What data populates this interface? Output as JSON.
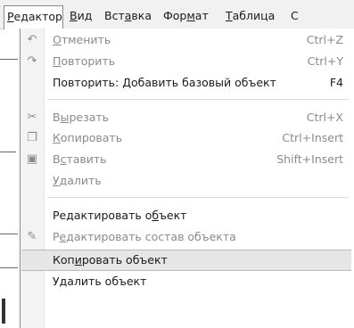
{
  "menubar": {
    "items": [
      {
        "text": "Редактор",
        "active": true
      },
      {
        "text": "Вид"
      },
      {
        "text": "Вставка"
      },
      {
        "text": "Формат"
      },
      {
        "text": "Таблица"
      },
      {
        "text": "С"
      }
    ]
  },
  "menu": {
    "undo": {
      "label": "Отменить",
      "shortcut": "Ctrl+Z",
      "icon": "undo-icon"
    },
    "redo": {
      "label": "Повторить",
      "shortcut": "Ctrl+Y",
      "icon": "redo-icon"
    },
    "repeat": {
      "label": "Повторить: Добавить базовый объект",
      "shortcut": "F4"
    },
    "cut": {
      "label": "Вырезать",
      "shortcut": "Ctrl+X",
      "icon": "scissors-icon"
    },
    "copy": {
      "label": "Копировать",
      "shortcut": "Ctrl+Insert",
      "icon": "copy-icon"
    },
    "paste": {
      "label": "Вставить",
      "shortcut": "Shift+Insert",
      "icon": "paste-icon"
    },
    "delete": {
      "label": "Удалить"
    },
    "edit_object": {
      "label": "Редактировать объект"
    },
    "edit_composition": {
      "label": "Редактировать состав объекта",
      "icon": "edit-composition-icon"
    },
    "copy_object": {
      "label": "Копировать объект"
    },
    "delete_object": {
      "label": "Удалить объект"
    }
  }
}
